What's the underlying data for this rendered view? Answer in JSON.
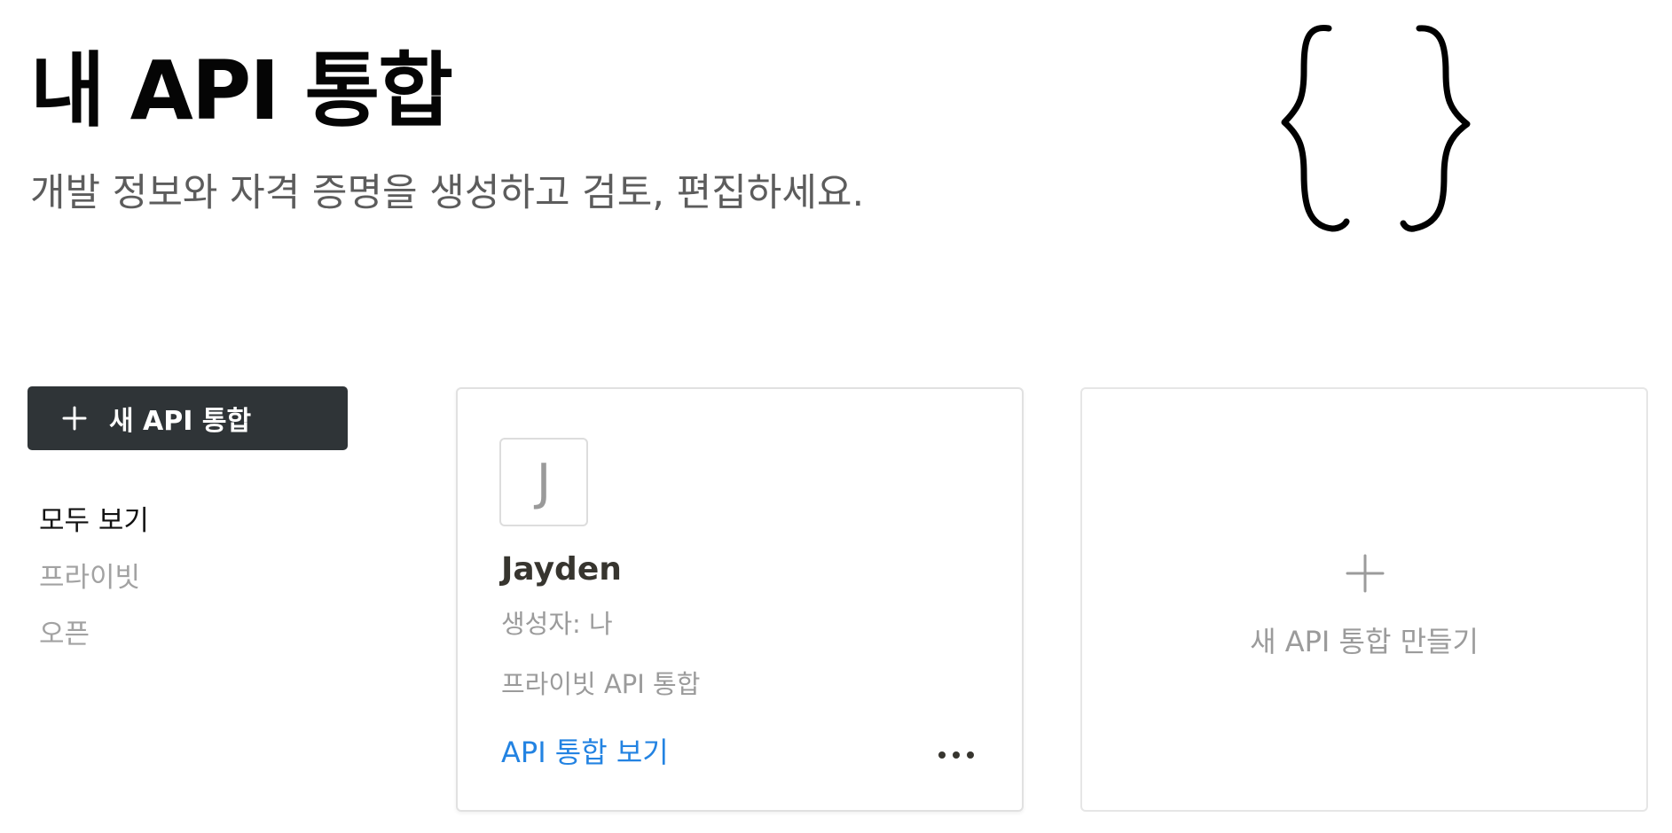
{
  "header": {
    "title": "내 API 통합",
    "subtitle": "개발 정보와 자격 증명을 생성하고 검토, 편집하세요."
  },
  "illustration": {
    "icon": "curly-braces-icon"
  },
  "sidebar": {
    "new_button": {
      "label": "새 API 통합",
      "icon": "plus-icon"
    },
    "filters": [
      {
        "label": "모두 보기",
        "active": true
      },
      {
        "label": "프라이빗",
        "active": false
      },
      {
        "label": "오픈",
        "active": false
      }
    ]
  },
  "cards": [
    {
      "avatar_letter": "J",
      "name": "Jayden",
      "creator": "생성자: 나",
      "type": "프라이빗 API 통합",
      "link_label": "API 통합 보기",
      "more_icon": "more-horizontal-icon"
    }
  ],
  "create_card": {
    "label": "새 API 통합 만들기",
    "icon": "plus-icon"
  },
  "colors": {
    "button_bg": "#2f3437",
    "link": "#2383e2",
    "muted_text": "#9b9b9b",
    "card_border": "#e1e1e1"
  }
}
